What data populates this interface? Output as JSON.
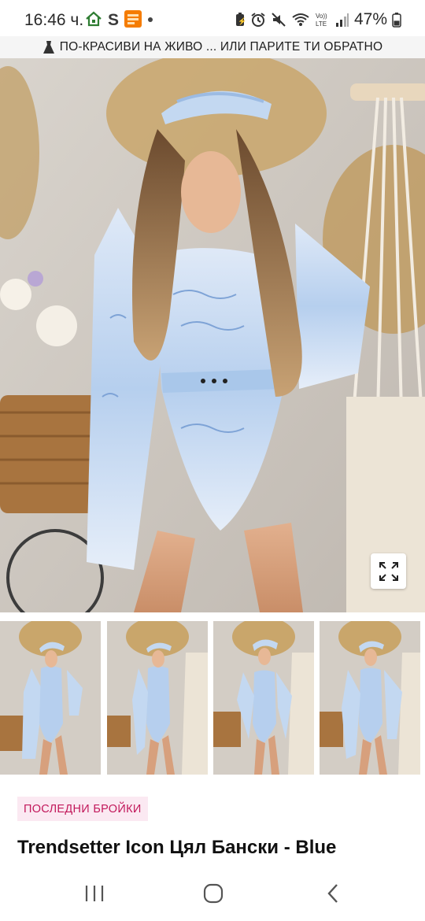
{
  "status_bar": {
    "time": "16:46 ч.",
    "battery_percent": "47%",
    "battery_level": 0.47,
    "left_icons": [
      "home-icon",
      "s-app-icon",
      "temu-app-icon",
      "dot-icon"
    ],
    "right_icons": [
      "battery-saver-icon",
      "alarm-icon",
      "mute-icon",
      "wifi-icon",
      "volte-icon",
      "signal-icon",
      "battery-icon"
    ],
    "volte_label": "Vo)) LTE"
  },
  "promo_bar": {
    "icon": "dress-icon",
    "text": "ПО-КРАСИВИ НА ЖИВО ... ИЛИ ПАРИТЕ ТИ ОБРАТНО"
  },
  "gallery": {
    "main_image_alt": "",
    "expand_icon": "expand-icon",
    "thumbnail_count": 4
  },
  "product": {
    "badge": "ПОСЛЕДНИ БРОЙКИ",
    "title": "Trendsetter Icon Цял Бански - Blue"
  },
  "nav_bar": {
    "buttons": [
      "recent-apps-icon",
      "home-icon",
      "back-icon"
    ]
  },
  "colors": {
    "badge_bg": "#fbe9f2",
    "badge_text": "#c2185b",
    "print_blue": "#a9c7ea",
    "wall": "#cfc9c2"
  }
}
